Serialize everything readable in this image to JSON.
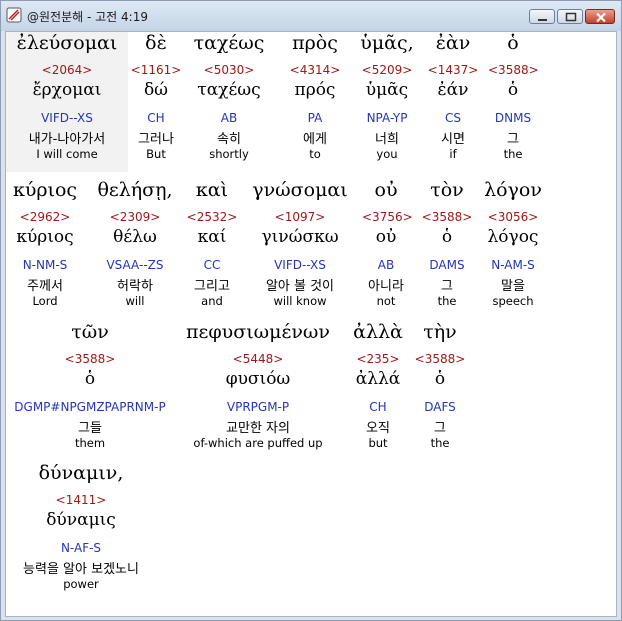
{
  "window": {
    "title": "@원전분해 - 고전 4:19"
  },
  "rows": [
    [
      {
        "greek": "ἐλεύσομαι",
        "strong": "<2064>",
        "lemma": "ἔρχομαι",
        "parse": "VIFD--XS",
        "korean": "내가-나아가서",
        "english": "I will come"
      },
      {
        "greek": "δὲ",
        "strong": "<1161>",
        "lemma": "δώ",
        "parse": "CH",
        "korean": "그러나",
        "english": "But"
      },
      {
        "greek": "ταχέως",
        "strong": "<5030>",
        "lemma": "ταχέως",
        "parse": "AB",
        "korean": "속히",
        "english": "shortly"
      },
      {
        "greek": "πρὸς",
        "strong": "<4314>",
        "lemma": "πρός",
        "parse": "PA",
        "korean": "에게",
        "english": "to"
      },
      {
        "greek": "ὑμᾶς,",
        "strong": "<5209>",
        "lemma": "ὑμᾶς",
        "parse": "NPA-YP",
        "korean": "너희",
        "english": "you"
      },
      {
        "greek": "ἐὰν",
        "strong": "<1437>",
        "lemma": "ἐάν",
        "parse": "CS",
        "korean": "시면",
        "english": "if"
      },
      {
        "greek": "ὁ",
        "strong": "<3588>",
        "lemma": "ὁ",
        "parse": "DNMS",
        "korean": "그",
        "english": "the"
      }
    ],
    [
      {
        "greek": "κύριος",
        "strong": "<2962>",
        "lemma": "κύριος",
        "parse": "N-NM-S",
        "korean": "주께서",
        "english": "Lord"
      },
      {
        "greek": "θελήσῃ,",
        "strong": "<2309>",
        "lemma": "θέλω",
        "parse": "VSAA--ZS",
        "korean": "허락하",
        "english": "will"
      },
      {
        "greek": "καὶ",
        "strong": "<2532>",
        "lemma": "καί",
        "parse": "CC",
        "korean": "그리고",
        "english": "and"
      },
      {
        "greek": "γνώσομαι",
        "strong": "<1097>",
        "lemma": "γινώσκω",
        "parse": "VIFD--XS",
        "korean": "알아 볼 것이",
        "english": "will know"
      },
      {
        "greek": "οὐ",
        "strong": "<3756>",
        "lemma": "οὐ",
        "parse": "AB",
        "korean": "아니라",
        "english": "not"
      },
      {
        "greek": "τὸν",
        "strong": "<3588>",
        "lemma": "ὁ",
        "parse": "DAMS",
        "korean": "그",
        "english": "the"
      },
      {
        "greek": "λόγον",
        "strong": "<3056>",
        "lemma": "λόγος",
        "parse": "N-AM-S",
        "korean": "말을",
        "english": "speech"
      }
    ],
    [
      {
        "greek": "τῶν",
        "strong": "<3588>",
        "lemma": "ὁ",
        "parse": "DGMP#NPGMZPAPRNM-P",
        "korean": "그들",
        "english": "them"
      },
      {
        "greek": "πεφυσιωμένων",
        "strong": "<5448>",
        "lemma": "φυσιόω",
        "parse": "VPRPGM-P",
        "korean": "교만한 자의",
        "english": "of-which are puffed up"
      },
      {
        "greek": "ἀλλὰ",
        "strong": "<235>",
        "lemma": "ἀλλά",
        "parse": "CH",
        "korean": "오직",
        "english": "but"
      },
      {
        "greek": "τὴν",
        "strong": "<3588>",
        "lemma": "ὁ",
        "parse": "DAFS",
        "korean": "그",
        "english": "the"
      }
    ],
    [
      {
        "greek": "δύναμιν,",
        "strong": "<1411>",
        "lemma": "δύναμις",
        "parse": "N-AF-S",
        "korean": "능력을 알아 보겠노니",
        "english": "power"
      }
    ]
  ]
}
